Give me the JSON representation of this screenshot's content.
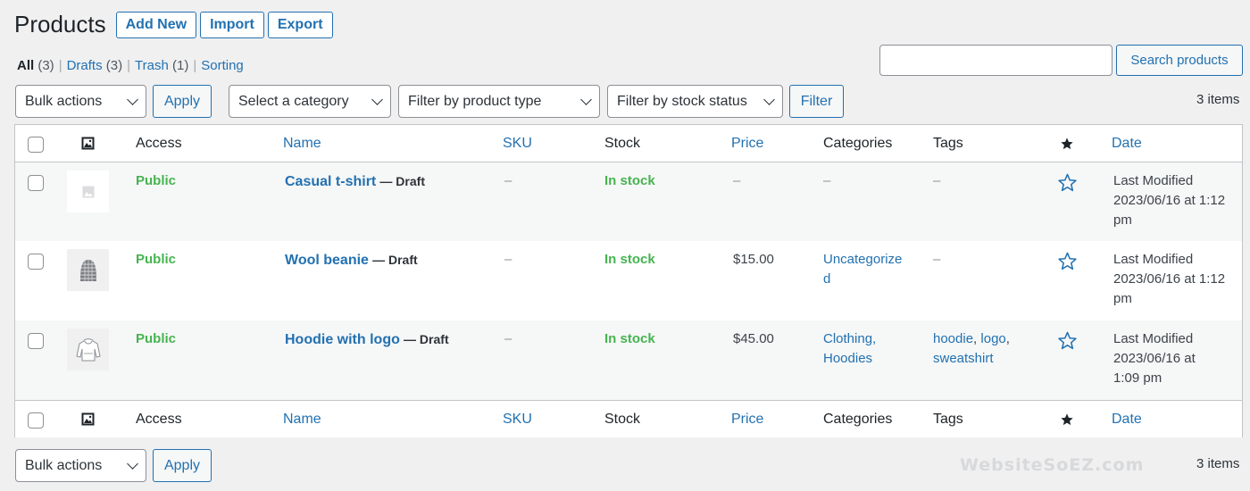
{
  "header": {
    "title": "Products",
    "add_new": "Add New",
    "import": "Import",
    "export": "Export"
  },
  "views": [
    {
      "label": "All",
      "count": "(3)"
    },
    {
      "label": "Drafts",
      "count": "(3)"
    },
    {
      "label": "Trash",
      "count": "(1)"
    },
    {
      "label": "Sorting",
      "count": ""
    }
  ],
  "search": {
    "placeholder": "",
    "button": "Search products"
  },
  "filters": {
    "bulk_actions": "Bulk actions",
    "apply": "Apply",
    "category": "Select a category",
    "product_type": "Filter by product type",
    "stock_status": "Filter by stock status",
    "filter": "Filter",
    "items": "3 items"
  },
  "columns": {
    "access": "Access",
    "name": "Name",
    "sku": "SKU",
    "stock": "Stock",
    "price": "Price",
    "categories": "Categories",
    "tags": "Tags",
    "date": "Date"
  },
  "products": [
    {
      "access": "Public",
      "name": "Casual t-shirt",
      "status": "— Draft",
      "sku": "–",
      "stock": "In stock",
      "price": "–",
      "categories": [
        "–"
      ],
      "tags": [
        "–"
      ],
      "date": [
        "Last Modified",
        "2023/06/16 at 1:12",
        "pm"
      ],
      "thumb": "placeholder"
    },
    {
      "access": "Public",
      "name": "Wool beanie",
      "status": "— Draft",
      "sku": "–",
      "stock": "In stock",
      "price": "$15.00",
      "categories": [
        "Uncategorize",
        "d"
      ],
      "tags": [
        "–"
      ],
      "date": [
        "Last Modified",
        "2023/06/16 at 1:12",
        "pm"
      ],
      "thumb": "beanie"
    },
    {
      "access": "Public",
      "name": "Hoodie with logo",
      "status": "— Draft",
      "sku": "–",
      "stock": "In stock",
      "price": "$45.00",
      "categories": [
        "Clothing,",
        "Hoodies"
      ],
      "tags": [
        "hoodie",
        ", ",
        "logo",
        ",",
        "sweatshirt"
      ],
      "date": [
        "Last Modified",
        "2023/06/16 at",
        "1:09 pm"
      ],
      "thumb": "hoodie"
    }
  ],
  "bottom": {
    "bulk_actions": "Bulk actions",
    "apply": "Apply",
    "items": "3 items"
  },
  "watermark": "WebsiteSoEZ.com",
  "colors": {
    "accent": "#2271b1",
    "in_stock": "#46b450",
    "stripe": "#f6f7f7"
  }
}
